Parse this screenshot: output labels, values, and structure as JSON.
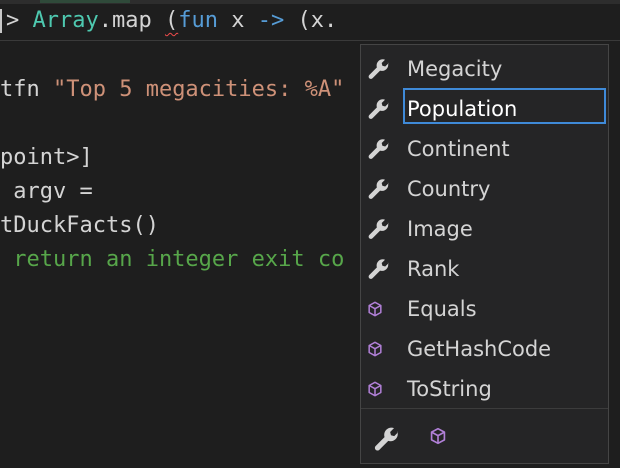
{
  "editor": {
    "lines": [
      {
        "prompt": "> ",
        "type": "Array",
        "method": ".map ",
        "open": "(",
        "kw": "fun",
        "rest": " x ",
        "arrow": "->",
        "tail": " (",
        "err": "x",
        "dot": "."
      },
      {
        "prefix": "tfn ",
        "string": "\"Top 5 megacities: %A\""
      },
      {
        "text": "point>]"
      },
      {
        "text": " argv ="
      },
      {
        "text": "tDuckFacts()"
      },
      {
        "comment": " return an integer exit co"
      }
    ]
  },
  "completion": {
    "items": [
      {
        "label": "Megacity",
        "icon": "wrench-icon",
        "kind": "property"
      },
      {
        "label": "Population",
        "icon": "wrench-icon",
        "kind": "property",
        "selected": true
      },
      {
        "label": "Continent",
        "icon": "wrench-icon",
        "kind": "property"
      },
      {
        "label": "Country",
        "icon": "wrench-icon",
        "kind": "property"
      },
      {
        "label": "Image",
        "icon": "wrench-icon",
        "kind": "property"
      },
      {
        "label": "Rank",
        "icon": "wrench-icon",
        "kind": "property"
      },
      {
        "label": "Equals",
        "icon": "cube-icon",
        "kind": "method"
      },
      {
        "label": "GetHashCode",
        "icon": "cube-icon",
        "kind": "method"
      },
      {
        "label": "ToString",
        "icon": "cube-icon",
        "kind": "method"
      }
    ],
    "filters": [
      {
        "icon": "wrench-icon",
        "name": "properties-filter"
      },
      {
        "icon": "cube-icon",
        "name": "methods-filter"
      }
    ],
    "colors": {
      "property_icon": "#d4d4d4",
      "method_icon": "#b180d7",
      "selection_border": "#3f8ad8"
    }
  }
}
